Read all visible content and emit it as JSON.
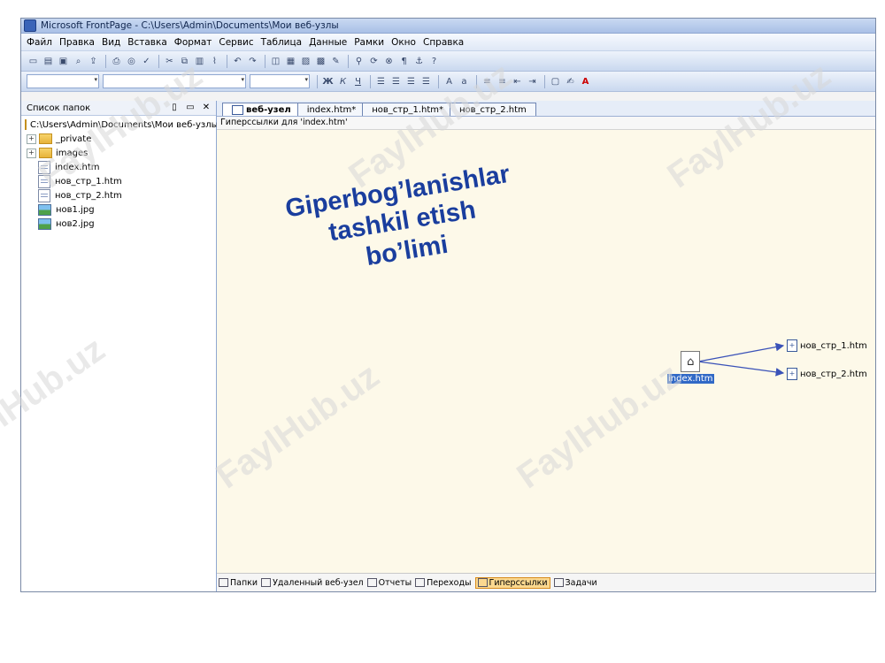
{
  "window": {
    "title": "Microsoft FrontPage - C:\\Users\\Admin\\Documents\\Мои веб-узлы"
  },
  "menu": [
    "Файл",
    "Правка",
    "Вид",
    "Вставка",
    "Формат",
    "Сервис",
    "Таблица",
    "Данные",
    "Рамки",
    "Окно",
    "Справка"
  ],
  "format_bar": {
    "bold": "Ж",
    "italic": "К",
    "underline": "Ч",
    "font_color": "A"
  },
  "folder_panel": {
    "title": "Список папок",
    "root": "C:\\Users\\Admin\\Documents\\Мои веб-узлы",
    "items": [
      {
        "label": "_private",
        "kind": "folder"
      },
      {
        "label": "images",
        "kind": "folder"
      },
      {
        "label": "index.htm",
        "kind": "home-page"
      },
      {
        "label": "нов_стр_1.htm",
        "kind": "page"
      },
      {
        "label": "нов_стр_2.htm",
        "kind": "page"
      },
      {
        "label": "нов1.jpg",
        "kind": "image"
      },
      {
        "label": "нов2.jpg",
        "kind": "image"
      }
    ]
  },
  "tabs": [
    {
      "label": "веб-узел",
      "active": true
    },
    {
      "label": "index.htm*",
      "active": false
    },
    {
      "label": "нов_стр_1.htm*",
      "active": false
    },
    {
      "label": "нов_стр_2.htm",
      "active": false
    }
  ],
  "crumb": "Гиперссылки для 'index.htm'",
  "overlay": [
    "Giperbog’lanishlar",
    "tashkil etish",
    "bo’limi"
  ],
  "hyperlinks": {
    "center": "index.htm",
    "targets": [
      "нов_стр_1.htm",
      "нов_стр_2.htm"
    ]
  },
  "views": [
    {
      "label": "Папки",
      "active": false
    },
    {
      "label": "Удаленный веб-узел",
      "active": false
    },
    {
      "label": "Отчеты",
      "active": false
    },
    {
      "label": "Переходы",
      "active": false
    },
    {
      "label": "Гиперссылки",
      "active": true
    },
    {
      "label": "Задачи",
      "active": false
    }
  ],
  "watermark": "FaylHub.uz",
  "colors": {
    "accent": "#3169c6",
    "overlay_text": "#1a3e9e",
    "canvas": "#fdf9e9",
    "active_view": "#fbd88f"
  }
}
